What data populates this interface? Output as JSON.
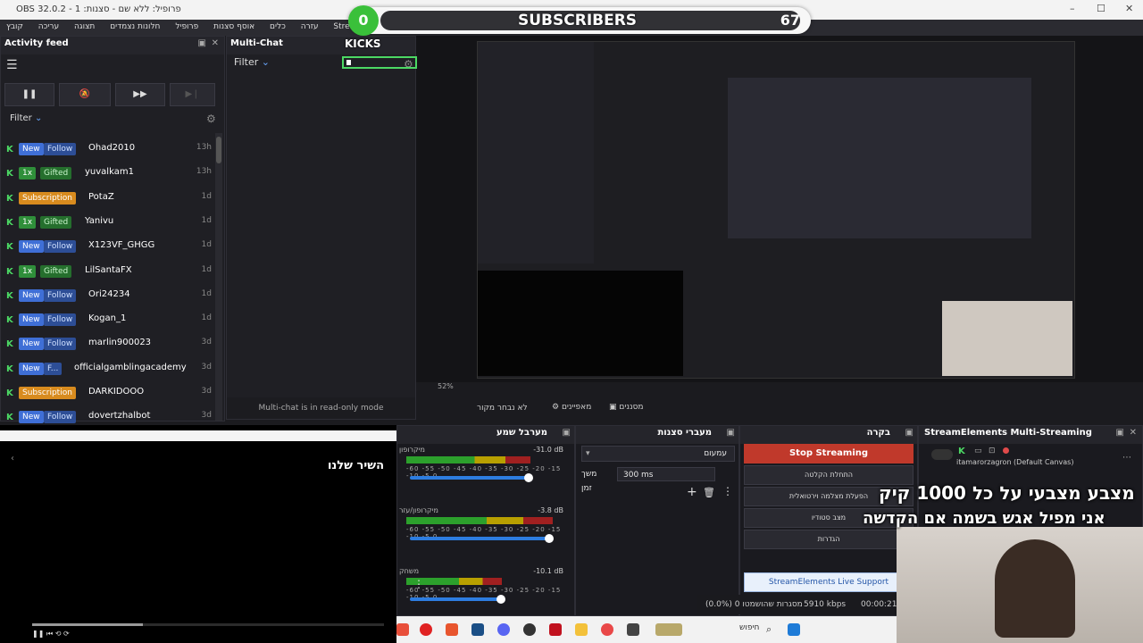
{
  "window": {
    "title": "OBS 32.0.2 - פרופיל: ללא שם - סצנות: 1",
    "minimize": "–",
    "maximize": "☐",
    "close": "✕"
  },
  "menu": {
    "items": [
      "קובץ",
      "עריכה",
      "תצוגה",
      "חלונות נצמדים",
      "פרופיל",
      "אוסף סצנות",
      "כלים",
      "עזרה",
      "StreamElements"
    ]
  },
  "activity_feed": {
    "title": "Activity feed",
    "filter_label": "Filter",
    "rows": [
      {
        "type": "Follow",
        "badge1": "New",
        "badge2": "Follow",
        "user": "Ohad2010",
        "age": "13h"
      },
      {
        "type": "Gifted",
        "badge1": "1x",
        "badge2": "Gifted",
        "user": "yuvalkam1",
        "age": "13h"
      },
      {
        "type": "Subscription",
        "badge1": "Subscription",
        "badge2": "",
        "user": "PotaZ",
        "age": "1d"
      },
      {
        "type": "Gifted",
        "badge1": "1x",
        "badge2": "Gifted",
        "user": "Yanivu",
        "age": "1d"
      },
      {
        "type": "Follow",
        "badge1": "New",
        "badge2": "Follow",
        "user": "X123VF_GHGG",
        "age": "1d"
      },
      {
        "type": "Gifted",
        "badge1": "1x",
        "badge2": "Gifted",
        "user": "LilSantaFX",
        "age": "1d"
      },
      {
        "type": "Follow",
        "badge1": "New",
        "badge2": "Follow",
        "user": "Ori24234",
        "age": "1d"
      },
      {
        "type": "Follow",
        "badge1": "New",
        "badge2": "Follow",
        "user": "Kogan_1",
        "age": "1d"
      },
      {
        "type": "Follow",
        "badge1": "New",
        "badge2": "Follow",
        "user": "marlin900023",
        "age": "3d"
      },
      {
        "type": "Follow",
        "badge1": "New",
        "badge2": "F...",
        "user": "officialgamblingacademy",
        "age": "3d"
      },
      {
        "type": "Subscription",
        "badge1": "Subscription",
        "badge2": "",
        "user": "DARKIDOOO",
        "age": "3d"
      },
      {
        "type": "Follow",
        "badge1": "New",
        "badge2": "Follow",
        "user": "dovertzhalbot",
        "age": "3d"
      }
    ]
  },
  "multichat": {
    "title": "Multi-Chat",
    "filter_label": "Filter",
    "readonly_notice": "Multi-chat is in read-only mode"
  },
  "overlay": {
    "subscribers_count": "0",
    "subscribers_title": "SUBSCRIBERS",
    "subscribers_goal": "67",
    "goal_progress": 0.0,
    "kicks_label": "KICKS"
  },
  "preview_toolbar": {
    "zoom": "52%",
    "lock_label": "לא נבחר מקור",
    "properties_label": "מאפיינים",
    "filters_label": "מסננים"
  },
  "mixer": {
    "title": "מערבל שמע",
    "channels": [
      {
        "label": "מיקרופון",
        "db": "-31.0 dB",
        "level": 0.78
      },
      {
        "label": "מיקרופון/עזר",
        "db": "-3.8 dB",
        "level": 0.92
      },
      {
        "label": "משחק",
        "db": "-10.1 dB",
        "level": 0.6
      }
    ],
    "scale": "-60 -55 -50 -45 -40 -35 -30 -25 -20 -15 -10 -5 0"
  },
  "transitions": {
    "title": "מעברי סצנות",
    "selected": "עמעום",
    "duration_label": "משך זמן",
    "duration_value": "300 ms"
  },
  "controls": {
    "title": "בקרה",
    "stop_streaming": "Stop Streaming",
    "start_recording": "התחלת הקלטה",
    "virtual_cam": "הפעלת מצלמה וירטואלית",
    "studio_mode": "מצב סטודיו",
    "settings": "הגדרות",
    "support": "StreamElements Live Support"
  },
  "multistream": {
    "title": "StreamElements Multi-Streaming",
    "canvas_label": "itamarorzagron (Default Canvas)"
  },
  "status": {
    "dropped": "(0.0%) 0 מסגרות שהושמטו",
    "bitrate": "5910 kbps",
    "time": "00:00:21"
  },
  "caption": {
    "line1": "מצבע מצבעי על כל 1000 קיק",
    "line2": "אני מפיל אגש בשמה אם הקדשה"
  },
  "colors": {
    "accent_green": "#4cd964",
    "stop_red": "#c0392b",
    "follow_blue": "#3f6fd6",
    "subscription_orange": "#d88b1e"
  }
}
